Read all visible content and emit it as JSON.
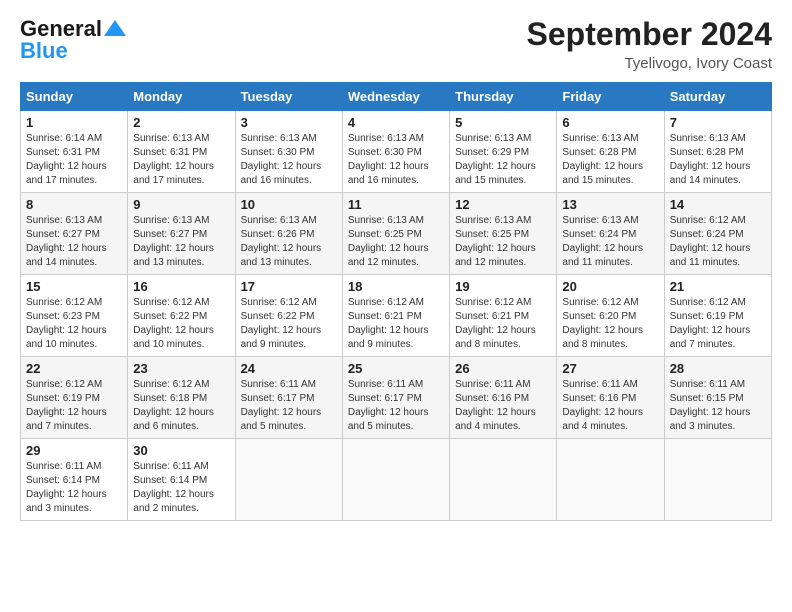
{
  "header": {
    "logo_line1": "General",
    "logo_line2": "Blue",
    "month": "September 2024",
    "location": "Tyelivogo, Ivory Coast"
  },
  "days_of_week": [
    "Sunday",
    "Monday",
    "Tuesday",
    "Wednesday",
    "Thursday",
    "Friday",
    "Saturday"
  ],
  "weeks": [
    [
      {
        "day": "1",
        "sunrise": "6:14 AM",
        "sunset": "6:31 PM",
        "daylight": "12 hours and 17 minutes."
      },
      {
        "day": "2",
        "sunrise": "6:13 AM",
        "sunset": "6:31 PM",
        "daylight": "12 hours and 17 minutes."
      },
      {
        "day": "3",
        "sunrise": "6:13 AM",
        "sunset": "6:30 PM",
        "daylight": "12 hours and 16 minutes."
      },
      {
        "day": "4",
        "sunrise": "6:13 AM",
        "sunset": "6:30 PM",
        "daylight": "12 hours and 16 minutes."
      },
      {
        "day": "5",
        "sunrise": "6:13 AM",
        "sunset": "6:29 PM",
        "daylight": "12 hours and 15 minutes."
      },
      {
        "day": "6",
        "sunrise": "6:13 AM",
        "sunset": "6:28 PM",
        "daylight": "12 hours and 15 minutes."
      },
      {
        "day": "7",
        "sunrise": "6:13 AM",
        "sunset": "6:28 PM",
        "daylight": "12 hours and 14 minutes."
      }
    ],
    [
      {
        "day": "8",
        "sunrise": "6:13 AM",
        "sunset": "6:27 PM",
        "daylight": "12 hours and 14 minutes."
      },
      {
        "day": "9",
        "sunrise": "6:13 AM",
        "sunset": "6:27 PM",
        "daylight": "12 hours and 13 minutes."
      },
      {
        "day": "10",
        "sunrise": "6:13 AM",
        "sunset": "6:26 PM",
        "daylight": "12 hours and 13 minutes."
      },
      {
        "day": "11",
        "sunrise": "6:13 AM",
        "sunset": "6:25 PM",
        "daylight": "12 hours and 12 minutes."
      },
      {
        "day": "12",
        "sunrise": "6:13 AM",
        "sunset": "6:25 PM",
        "daylight": "12 hours and 12 minutes."
      },
      {
        "day": "13",
        "sunrise": "6:13 AM",
        "sunset": "6:24 PM",
        "daylight": "12 hours and 11 minutes."
      },
      {
        "day": "14",
        "sunrise": "6:12 AM",
        "sunset": "6:24 PM",
        "daylight": "12 hours and 11 minutes."
      }
    ],
    [
      {
        "day": "15",
        "sunrise": "6:12 AM",
        "sunset": "6:23 PM",
        "daylight": "12 hours and 10 minutes."
      },
      {
        "day": "16",
        "sunrise": "6:12 AM",
        "sunset": "6:22 PM",
        "daylight": "12 hours and 10 minutes."
      },
      {
        "day": "17",
        "sunrise": "6:12 AM",
        "sunset": "6:22 PM",
        "daylight": "12 hours and 9 minutes."
      },
      {
        "day": "18",
        "sunrise": "6:12 AM",
        "sunset": "6:21 PM",
        "daylight": "12 hours and 9 minutes."
      },
      {
        "day": "19",
        "sunrise": "6:12 AM",
        "sunset": "6:21 PM",
        "daylight": "12 hours and 8 minutes."
      },
      {
        "day": "20",
        "sunrise": "6:12 AM",
        "sunset": "6:20 PM",
        "daylight": "12 hours and 8 minutes."
      },
      {
        "day": "21",
        "sunrise": "6:12 AM",
        "sunset": "6:19 PM",
        "daylight": "12 hours and 7 minutes."
      }
    ],
    [
      {
        "day": "22",
        "sunrise": "6:12 AM",
        "sunset": "6:19 PM",
        "daylight": "12 hours and 7 minutes."
      },
      {
        "day": "23",
        "sunrise": "6:12 AM",
        "sunset": "6:18 PM",
        "daylight": "12 hours and 6 minutes."
      },
      {
        "day": "24",
        "sunrise": "6:11 AM",
        "sunset": "6:17 PM",
        "daylight": "12 hours and 5 minutes."
      },
      {
        "day": "25",
        "sunrise": "6:11 AM",
        "sunset": "6:17 PM",
        "daylight": "12 hours and 5 minutes."
      },
      {
        "day": "26",
        "sunrise": "6:11 AM",
        "sunset": "6:16 PM",
        "daylight": "12 hours and 4 minutes."
      },
      {
        "day": "27",
        "sunrise": "6:11 AM",
        "sunset": "6:16 PM",
        "daylight": "12 hours and 4 minutes."
      },
      {
        "day": "28",
        "sunrise": "6:11 AM",
        "sunset": "6:15 PM",
        "daylight": "12 hours and 3 minutes."
      }
    ],
    [
      {
        "day": "29",
        "sunrise": "6:11 AM",
        "sunset": "6:14 PM",
        "daylight": "12 hours and 3 minutes."
      },
      {
        "day": "30",
        "sunrise": "6:11 AM",
        "sunset": "6:14 PM",
        "daylight": "12 hours and 2 minutes."
      },
      null,
      null,
      null,
      null,
      null
    ]
  ]
}
